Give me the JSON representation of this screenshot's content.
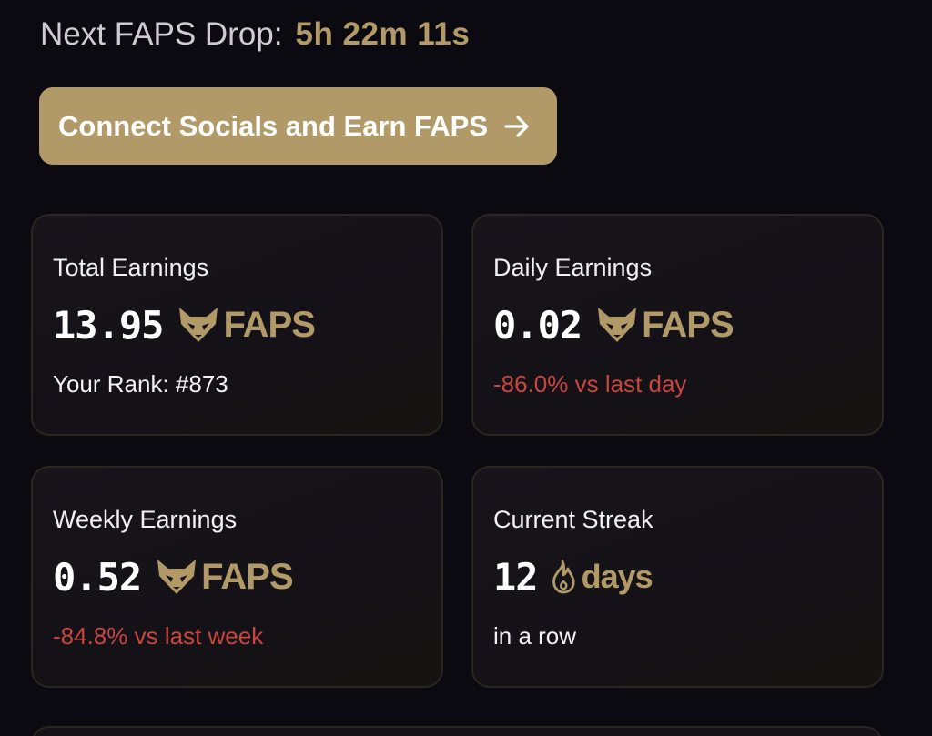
{
  "header": {
    "drop_label": "Next FAPS Drop:",
    "drop_timer": "5h 22m 11s"
  },
  "connect_button": {
    "label": "Connect Socials and Earn FAPS"
  },
  "cards": {
    "total": {
      "label": "Total Earnings",
      "value": "13.95",
      "unit": "FAPS",
      "sub": "Your Rank: #873"
    },
    "daily": {
      "label": "Daily Earnings",
      "value": "0.02",
      "unit": "FAPS",
      "sub": "-86.0% vs last day"
    },
    "weekly": {
      "label": "Weekly Earnings",
      "value": "0.52",
      "unit": "FAPS",
      "sub": "-84.8% vs last week"
    },
    "streak": {
      "label": "Current Streak",
      "value": "12",
      "unit": "days",
      "sub": "in a row"
    }
  },
  "colors": {
    "accent": "#b29a68",
    "negative": "#c8463f",
    "background": "#0b0a10"
  },
  "icons": {
    "token_icon": "fox-head-icon",
    "streak_icon": "flame-icon",
    "button_icon": "arrow-right-icon"
  }
}
